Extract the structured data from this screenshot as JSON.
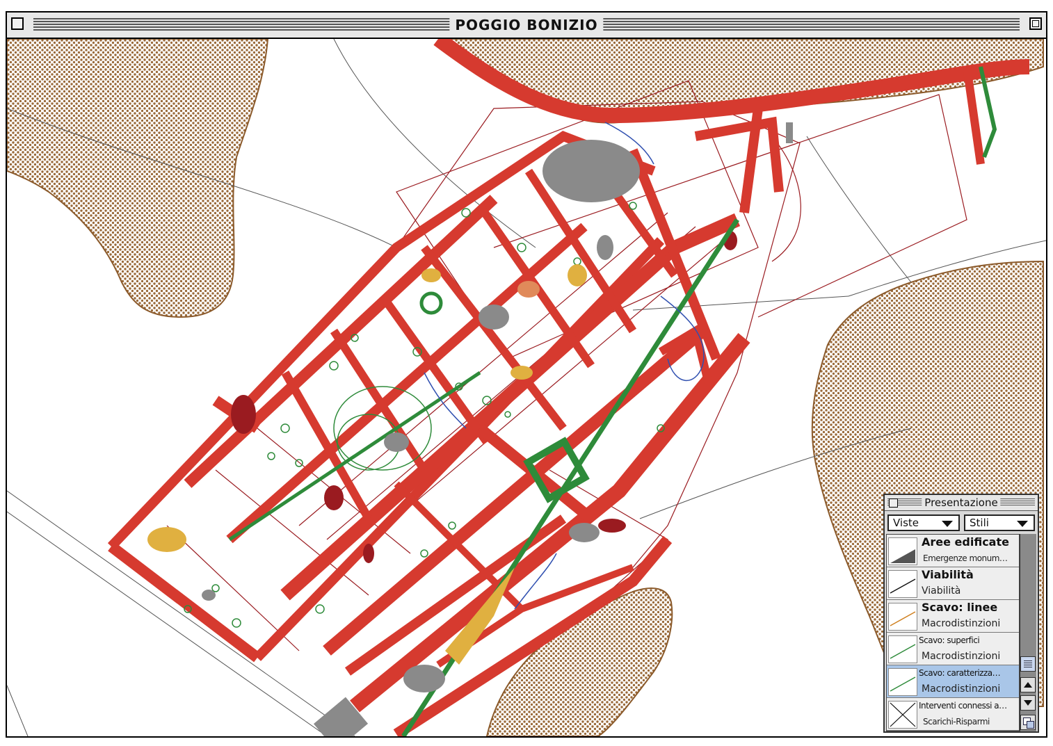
{
  "window": {
    "title": "POGGIO BONIZIO"
  },
  "map": {
    "description_colors": {
      "terrain_fill": "#8b5a2b",
      "walls_red": "#d63a2f",
      "features_dark_red": "#9a1b20",
      "green": "#2e8b3a",
      "grey": "#808080",
      "yellow": "#e0b040",
      "blue": "#3050b0",
      "orange": "#e08030"
    }
  },
  "palette": {
    "title": "Presentazione",
    "viste_label": "Viste",
    "stili_label": "Stili",
    "layers": [
      {
        "name": "Aree edificate",
        "sub": "Emergenze monum…"
      },
      {
        "name": "Viabilità",
        "sub": "Viabilità"
      },
      {
        "name": "Scavo: linee",
        "sub": "Macrodistinzioni"
      },
      {
        "name": "Scavo: superfici",
        "sub": "Macrodistinzioni"
      },
      {
        "name": "Scavo: caratterizza…",
        "sub": "Macrodistinzioni"
      },
      {
        "name": "Interventi connessi a…",
        "sub": "Scarichi-Risparmi"
      }
    ]
  }
}
